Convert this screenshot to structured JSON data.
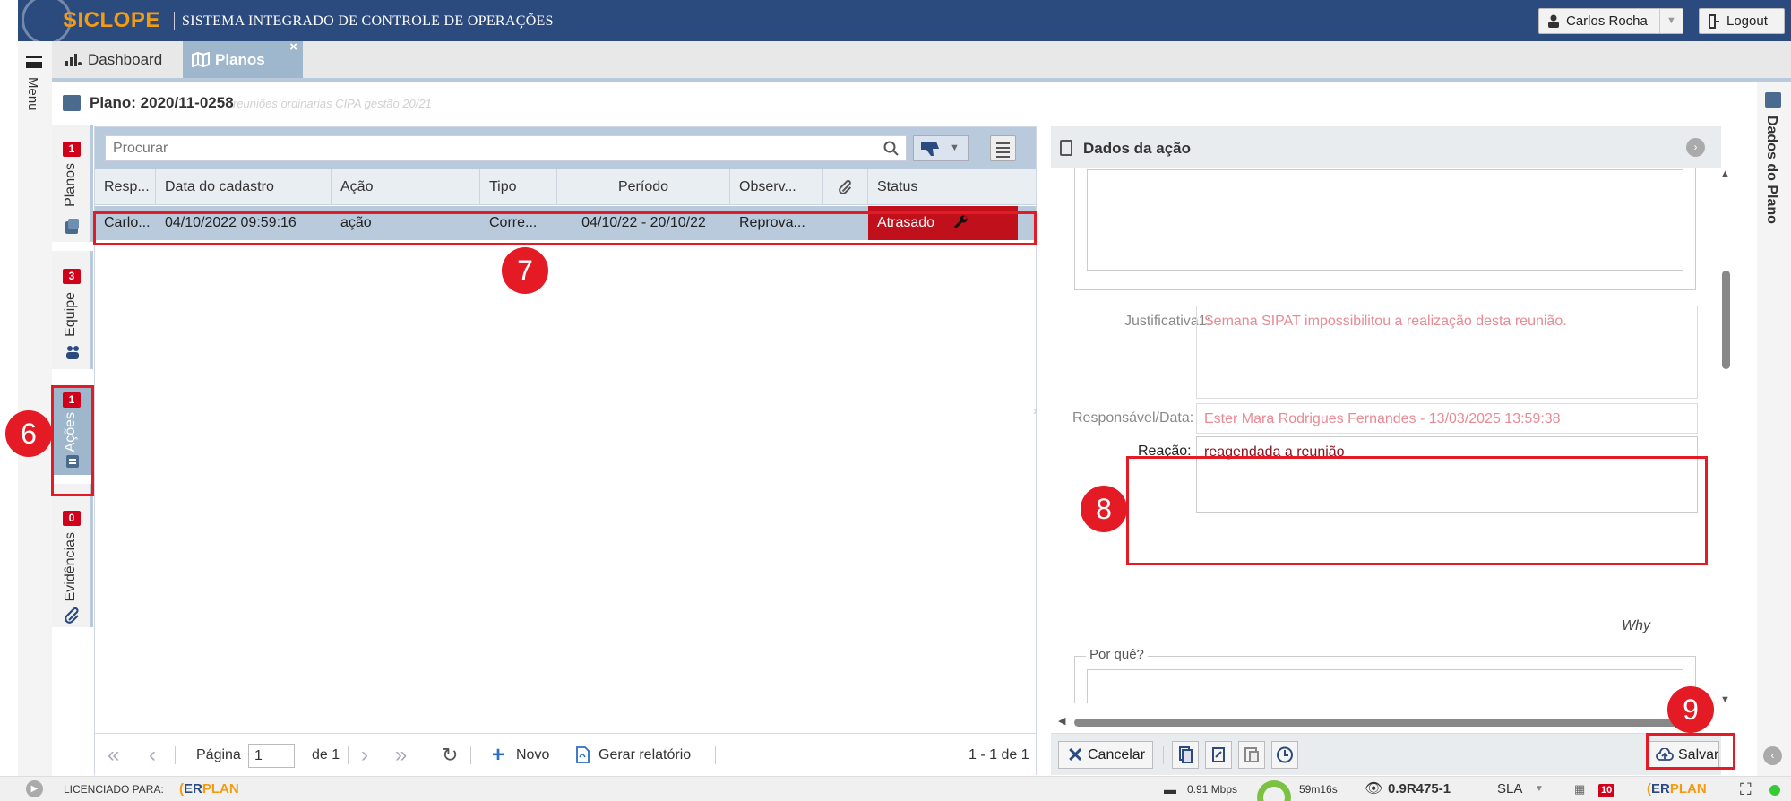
{
  "app": {
    "logo_text": "SICLOPE",
    "system_title": "SISTEMA INTEGRADO DE CONTROLE DE OPERAÇÕES",
    "user_name": "Carlos Rocha",
    "logout_label": "Logout",
    "menu_label": "Menu"
  },
  "tabs": [
    {
      "label": "Dashboard",
      "icon": "bar-chart-icon",
      "active": false
    },
    {
      "label": "Planos",
      "icon": "map-icon",
      "active": true,
      "close": "×"
    }
  ],
  "plan": {
    "title": "Plano: 2020/11-0258",
    "subtitle": "reuniões ordinarias CIPA gestão 20/21"
  },
  "side_tabs": [
    {
      "label": "Planos",
      "badge": "1",
      "icon": "plan-icon"
    },
    {
      "label": "Equipe",
      "badge": "3",
      "icon": "team-icon"
    },
    {
      "label": "Ações",
      "badge": "1",
      "icon": "actions-icon",
      "active": true
    },
    {
      "label": "Evidências",
      "badge": "0",
      "icon": "paperclip-icon"
    }
  ],
  "list": {
    "search_placeholder": "Procurar",
    "columns": [
      "Resp...",
      "Data do cadastro",
      "Ação",
      "Tipo",
      "Período",
      "Observ...",
      "",
      "Status"
    ],
    "rows": [
      {
        "resp": "Carlo...",
        "data": "04/10/2022 09:59:16",
        "acao": "ação",
        "tipo": "Corre...",
        "periodo": "04/10/22 - 20/10/22",
        "obs": "Reprova...",
        "anexo": "",
        "status": "Atrasado"
      }
    ],
    "pager": {
      "page_label": "Página",
      "page_value": "1",
      "of_label": "de 1",
      "new_label": "Novo",
      "report_label": "Gerar relatório",
      "range_label": "1 - 1 de 1"
    }
  },
  "detail": {
    "title": "Dados da ação",
    "justificativa_label": "Justificativa1:",
    "justificativa_value": "Semana SIPAT impossibilitou a realização desta reunião.",
    "responsavel_label": "Responsável/Data:",
    "responsavel_value": "Ester Mara Rodrigues Fernandes - 13/03/2025 13:59:38",
    "reacao_label": "Reação:",
    "reacao_value": "reagendada a reunião",
    "why_label": "Why",
    "porque_legend": "Por quê?",
    "cancel_label": "Cancelar",
    "save_label": "Salvar"
  },
  "right_rail": {
    "label": "Dados do Plano"
  },
  "statusbar": {
    "licensed_label": "LICENCIADO PARA:",
    "brand_er": "ER",
    "brand_plan": "PLAN",
    "speed": "0.91 Mbps",
    "timer": "59m16s",
    "version": "0.9R475-1",
    "sla": "SLA",
    "badge": "10"
  },
  "annotations": [
    "6",
    "7",
    "8",
    "9"
  ],
  "colors": {
    "header_bg": "#2b4a7e",
    "accent": "#9fb7cd",
    "status_late": "#c0101b",
    "annotation": "#e41b24"
  }
}
